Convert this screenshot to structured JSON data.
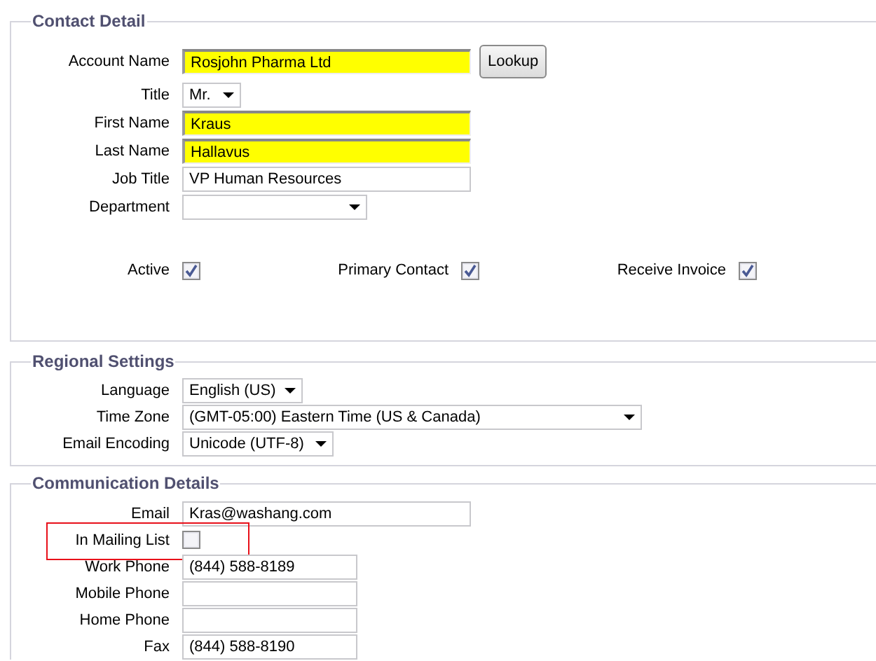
{
  "sections": [
    {
      "title": "Contact Detail",
      "fields": [
        {
          "kind": "text",
          "label": "Account Name",
          "value": "Rosjohn Pharma Ltd",
          "required": true,
          "button": "Lookup"
        },
        {
          "kind": "select",
          "label": "Title",
          "value": "Mr."
        },
        {
          "kind": "text",
          "label": "First Name",
          "value": "Kraus",
          "required": true
        },
        {
          "kind": "text",
          "label": "Last Name",
          "value": "Hallavus",
          "required": true
        },
        {
          "kind": "text",
          "label": "Job Title",
          "value": "VP Human Resources",
          "required": false
        },
        {
          "kind": "select",
          "label": "Department"
        }
      ],
      "flags": [
        {
          "label": "Active",
          "checked": true
        },
        {
          "label": "Primary Contact",
          "checked": true
        },
        {
          "label": "Receive Invoice",
          "checked": true
        }
      ]
    },
    {
      "title": "Regional Settings",
      "fields": [
        {
          "kind": "select",
          "label": "Language",
          "value": "English (US)"
        },
        {
          "kind": "select",
          "label": "Time Zone",
          "value": "(GMT-05:00) Eastern Time (US & Canada)"
        },
        {
          "kind": "select",
          "label": "Email Encoding",
          "value": "Unicode (UTF-8)"
        }
      ]
    },
    {
      "title": "Communication Details",
      "fields": [
        {
          "kind": "text",
          "label": "Email",
          "value": "Kras@washang.com",
          "required": false,
          "highlighted": false
        },
        {
          "kind": "checkbox",
          "label": "In Mailing List",
          "checked": false,
          "highlighted": true
        },
        {
          "kind": "text",
          "label": "Work Phone",
          "value": "(844) 588-8189",
          "required": false,
          "highlighted": false
        },
        {
          "kind": "text",
          "label": "Mobile Phone",
          "required": false,
          "highlighted": false
        },
        {
          "kind": "text",
          "label": "Home Phone",
          "required": false,
          "highlighted": false
        },
        {
          "kind": "text",
          "label": "Fax",
          "value": "(844) 588-8190",
          "required": false,
          "highlighted": false
        }
      ]
    }
  ]
}
